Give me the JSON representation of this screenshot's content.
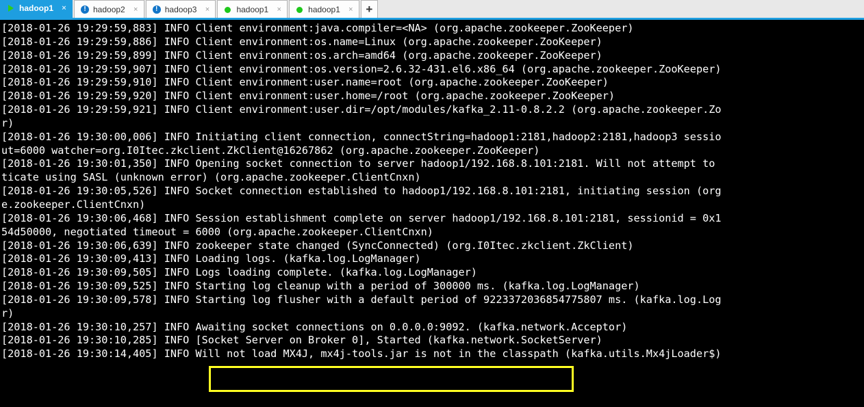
{
  "window": {
    "accent_color": "#1e9ee0",
    "tabbar_bg": "#e8e8e8",
    "terminal_bg": "#000000",
    "terminal_fg": "#ffffff",
    "highlight_color": "#ffff22"
  },
  "tabs": [
    {
      "label": "hadoop1",
      "icon": "play-icon",
      "status": "connected",
      "active": true,
      "close_label": "×"
    },
    {
      "label": "hadoop2",
      "icon": "info-icon",
      "status": "alert",
      "active": false,
      "close_label": "×"
    },
    {
      "label": "hadoop3",
      "icon": "info-icon",
      "status": "alert",
      "active": false,
      "close_label": "×"
    },
    {
      "label": "hadoop1",
      "icon": "dot-icon",
      "status": "idle",
      "active": false,
      "close_label": "×"
    },
    {
      "label": "hadoop1",
      "icon": "dot-icon",
      "status": "idle",
      "active": false,
      "close_label": "×"
    }
  ],
  "new_tab_label": "+",
  "terminal": {
    "lines": [
      "[2018-01-26 19:29:59,883] INFO Client environment:java.compiler=<NA> (org.apache.zookeeper.ZooKeeper)",
      "[2018-01-26 19:29:59,886] INFO Client environment:os.name=Linux (org.apache.zookeeper.ZooKeeper)",
      "[2018-01-26 19:29:59,899] INFO Client environment:os.arch=amd64 (org.apache.zookeeper.ZooKeeper)",
      "[2018-01-26 19:29:59,907] INFO Client environment:os.version=2.6.32-431.el6.x86_64 (org.apache.zookeeper.ZooKeeper)",
      "[2018-01-26 19:29:59,910] INFO Client environment:user.name=root (org.apache.zookeeper.ZooKeeper)",
      "[2018-01-26 19:29:59,920] INFO Client environment:user.home=/root (org.apache.zookeeper.ZooKeeper)",
      "[2018-01-26 19:29:59,921] INFO Client environment:user.dir=/opt/modules/kafka_2.11-0.8.2.2 (org.apache.zookeeper.Zo",
      "r)",
      "[2018-01-26 19:30:00,006] INFO Initiating client connection, connectString=hadoop1:2181,hadoop2:2181,hadoop3 sessio",
      "ut=6000 watcher=org.I0Itec.zkclient.ZkClient@16267862 (org.apache.zookeeper.ZooKeeper)",
      "[2018-01-26 19:30:01,350] INFO Opening socket connection to server hadoop1/192.168.8.101:2181. Will not attempt to ",
      "ticate using SASL (unknown error) (org.apache.zookeeper.ClientCnxn)",
      "[2018-01-26 19:30:05,526] INFO Socket connection established to hadoop1/192.168.8.101:2181, initiating session (org",
      "e.zookeeper.ClientCnxn)",
      "[2018-01-26 19:30:06,468] INFO Session establishment complete on server hadoop1/192.168.8.101:2181, sessionid = 0x1",
      "54d50000, negotiated timeout = 6000 (org.apache.zookeeper.ClientCnxn)",
      "[2018-01-26 19:30:06,639] INFO zookeeper state changed (SyncConnected) (org.I0Itec.zkclient.ZkClient)",
      "[2018-01-26 19:30:09,413] INFO Loading logs. (kafka.log.LogManager)",
      "[2018-01-26 19:30:09,505] INFO Logs loading complete. (kafka.log.LogManager)",
      "[2018-01-26 19:30:09,525] INFO Starting log cleanup with a period of 300000 ms. (kafka.log.LogManager)",
      "[2018-01-26 19:30:09,578] INFO Starting log flusher with a default period of 9223372036854775807 ms. (kafka.log.Log",
      "r)",
      "[2018-01-26 19:30:10,257] INFO Awaiting socket connections on 0.0.0.0:9092. (kafka.network.Acceptor)",
      "[2018-01-26 19:30:10,285] INFO [Socket Server on Broker 0], Started (kafka.network.SocketServer)",
      "[2018-01-26 19:30:14,405] INFO Will not load MX4J, mx4j-tools.jar is not in the classpath (kafka.utils.Mx4jLoader$)"
    ],
    "highlight": {
      "text": "Awaiting socket connections on 0.0.0.0:9092.",
      "line_index": 22
    }
  }
}
